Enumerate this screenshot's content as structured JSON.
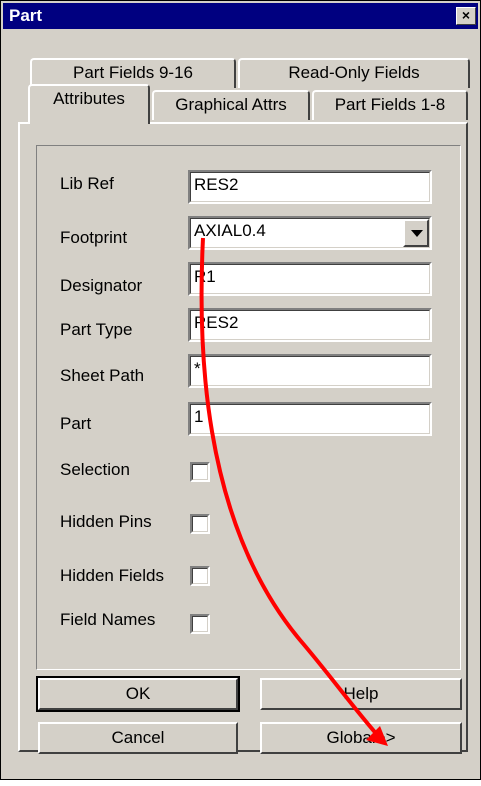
{
  "window": {
    "title": "Part",
    "close_label": "×"
  },
  "tabs": {
    "back_row": [
      "Part Fields 9-16",
      "Read-Only Fields"
    ],
    "front_row": [
      "Attributes",
      "Graphical Attrs",
      "Part Fields 1-8"
    ],
    "active": "Attributes"
  },
  "form": {
    "lib_ref": {
      "label": "Lib Ref",
      "value": "RES2"
    },
    "footprint": {
      "label": "Footprint",
      "value": "AXIAL0.4"
    },
    "designator": {
      "label": "Designator",
      "value": "R1"
    },
    "part_type": {
      "label": "Part Type",
      "value": "RES2"
    },
    "sheet_path": {
      "label": "Sheet Path",
      "value": "*"
    },
    "part": {
      "label": "Part",
      "value": "1"
    },
    "selection": {
      "label": "Selection",
      "checked": false
    },
    "hidden_pins": {
      "label": "Hidden Pins",
      "checked": false
    },
    "hidden_fields": {
      "label": "Hidden Fields",
      "checked": false
    },
    "field_names": {
      "label": "Field Names",
      "checked": false
    }
  },
  "buttons": {
    "ok": "OK",
    "help": "Help",
    "cancel": "Cancel",
    "global": "Global>>"
  },
  "annotation": {
    "arrow_color": "#ff0000"
  },
  "colors": {
    "title_bar": "#000080",
    "face": "#d4d0c8"
  }
}
